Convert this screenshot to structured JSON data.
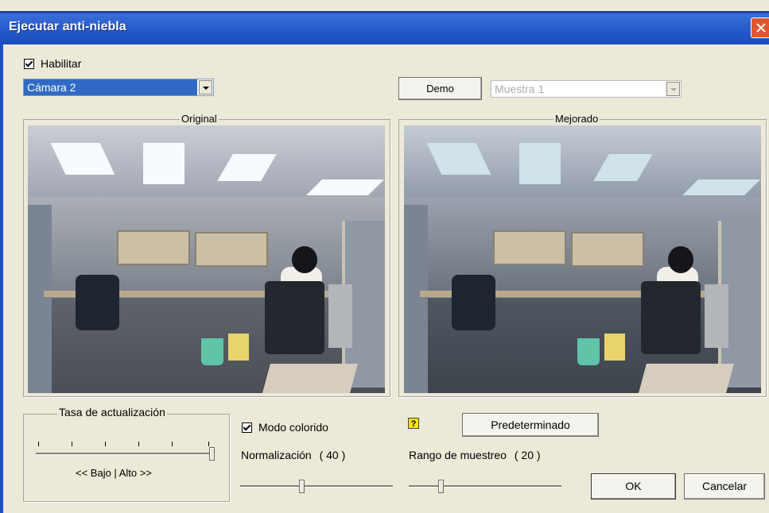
{
  "dialog": {
    "title": "Ejecutar anti-niebla",
    "enable": {
      "label": "Habilitar",
      "checked": true
    },
    "camera_select": {
      "selected": "Cámara 2"
    },
    "demo_button": {
      "label": "Demo"
    },
    "sample_select": {
      "selected": "Muestra 1",
      "disabled": true
    },
    "original_group": {
      "label": "Original"
    },
    "enhanced_group": {
      "label": "Mejorado"
    },
    "refresh_group": {
      "label": "Tasa de actualización",
      "slider_value": 1.0,
      "low_high_label": "<< Bajo | Alto >>"
    },
    "color_mode": {
      "label": "Modo colorido",
      "checked": true
    },
    "normalization": {
      "label": "Normalización",
      "value": "( 40 )",
      "level": 0.4
    },
    "help_icon": {
      "glyph": "?",
      "name": "help-icon"
    },
    "default_button": {
      "label": "Predeterminado"
    },
    "sampling_range": {
      "label": "Rango de muestreo",
      "value": "( 20 )",
      "level": 0.2
    },
    "ok_button": {
      "label": "OK"
    },
    "cancel_button": {
      "label": "Cancelar"
    }
  },
  "colors": {
    "title_bar": "#2a5fd0",
    "close_button": "#e0562c",
    "selection": "#316ac5",
    "window_bg": "#ece9d8"
  }
}
